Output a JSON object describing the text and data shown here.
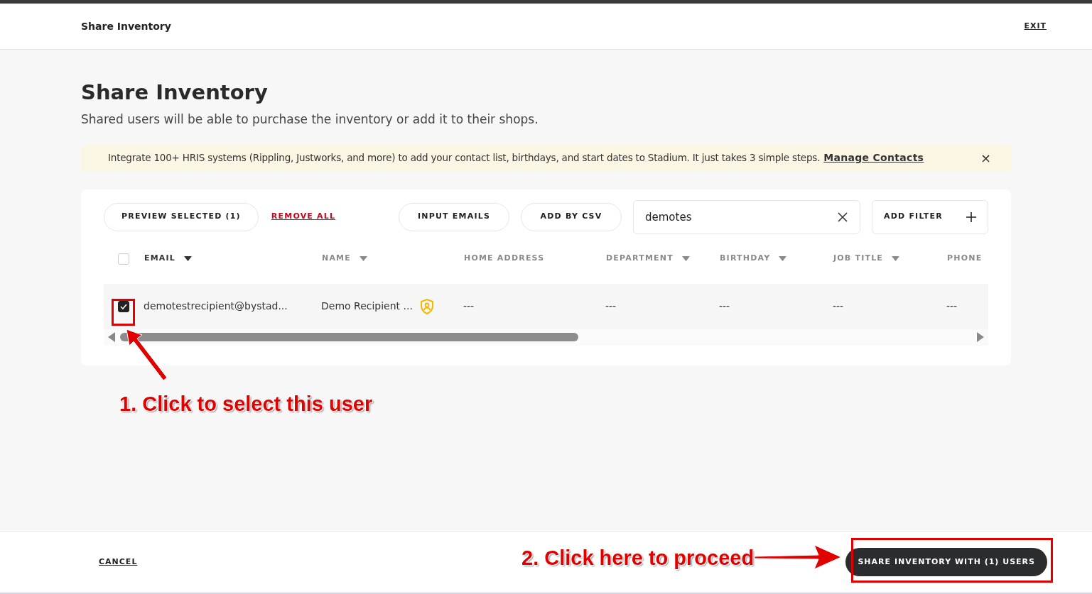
{
  "header": {
    "title": "Share Inventory",
    "exit": "EXIT"
  },
  "page": {
    "title": "Share Inventory",
    "subtitle": "Shared users will be able to purchase the inventory or add it to their shops."
  },
  "banner": {
    "text": "Integrate 100+ HRIS systems (Rippling, Justworks, and more) to add your contact list, birthdays, and start dates to Stadium. It just takes 3 simple steps.",
    "link": "Manage Contacts",
    "close": "×"
  },
  "toolbar": {
    "preview": "PREVIEW SELECTED (1)",
    "remove_all": "REMOVE ALL",
    "input_emails": "INPUT EMAILS",
    "add_by_csv": "ADD BY CSV",
    "search": {
      "value": "demotes"
    },
    "add_filter": "ADD FILTER"
  },
  "table": {
    "all_checked": false,
    "columns": [
      {
        "label": "EMAIL",
        "sortable": true,
        "active": true
      },
      {
        "label": "NAME",
        "sortable": true,
        "active": false
      },
      {
        "label": "HOME ADDRESS",
        "sortable": false,
        "active": false
      },
      {
        "label": "DEPARTMENT",
        "sortable": true,
        "active": false
      },
      {
        "label": "BIRTHDAY",
        "sortable": true,
        "active": false
      },
      {
        "label": "JOB TITLE",
        "sortable": true,
        "active": false
      },
      {
        "label": "PHONE",
        "sortable": false,
        "active": false
      }
    ],
    "rows": [
      {
        "checked": true,
        "admin": true,
        "cells": [
          "demotestrecipient@bystad...",
          "Demo Recipient ...",
          "---",
          "---",
          "---",
          "---",
          "---"
        ]
      }
    ]
  },
  "footer": {
    "cancel": "CANCEL",
    "share": "SHARE INVENTORY WITH (1) USERS"
  },
  "annotations": [
    {
      "text": "1. Click to select this user"
    },
    {
      "text": "2. Click here to proceed"
    }
  ]
}
